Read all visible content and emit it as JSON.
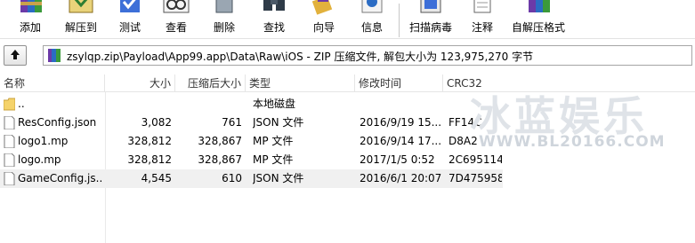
{
  "toolbar": {
    "buttons": [
      {
        "label": "添加",
        "icon": "add-archive-icon"
      },
      {
        "label": "解压到",
        "icon": "extract-to-icon"
      },
      {
        "label": "测试",
        "icon": "test-icon"
      },
      {
        "label": "查看",
        "icon": "view-icon"
      },
      {
        "label": "删除",
        "icon": "delete-icon"
      },
      {
        "label": "查找",
        "icon": "find-icon"
      },
      {
        "label": "向导",
        "icon": "wizard-icon"
      },
      {
        "label": "信息",
        "icon": "info-icon"
      },
      {
        "label": "扫描病毒",
        "icon": "scan-virus-icon"
      },
      {
        "label": "注释",
        "icon": "comment-icon"
      },
      {
        "label": "自解压格式",
        "icon": "sfx-icon"
      }
    ]
  },
  "addressbar": {
    "path": "zsylqp.zip\\Payload\\App99.app\\Data\\Raw\\iOS - ZIP 压缩文件, 解包大小为 123,975,270 字节"
  },
  "columns": {
    "name": "名称",
    "size": "大小",
    "packed": "压缩后大小",
    "type": "类型",
    "modified": "修改时间",
    "crc": "CRC32"
  },
  "files": [
    {
      "name": "..",
      "size": "",
      "packed": "",
      "type": "本地磁盘",
      "modified": "",
      "crc": ""
    },
    {
      "name": "ResConfig.json",
      "size": "3,082",
      "packed": "761",
      "type": "JSON 文件",
      "modified": "2016/9/19 15...",
      "crc": "FF14C"
    },
    {
      "name": "logo1.mp",
      "size": "328,812",
      "packed": "328,867",
      "type": "MP 文件",
      "modified": "2016/9/14 17...",
      "crc": "D8A2"
    },
    {
      "name": "logo.mp",
      "size": "328,812",
      "packed": "328,867",
      "type": "MP 文件",
      "modified": "2017/1/5 0:52",
      "crc": "2C695114"
    },
    {
      "name": "GameConfig.js...",
      "size": "4,545",
      "packed": "610",
      "type": "JSON 文件",
      "modified": "2016/6/1 20:07",
      "crc": "7D475958"
    }
  ],
  "watermark": {
    "title": "冰蓝娱乐",
    "url": "WWW.BL20166.COM"
  }
}
